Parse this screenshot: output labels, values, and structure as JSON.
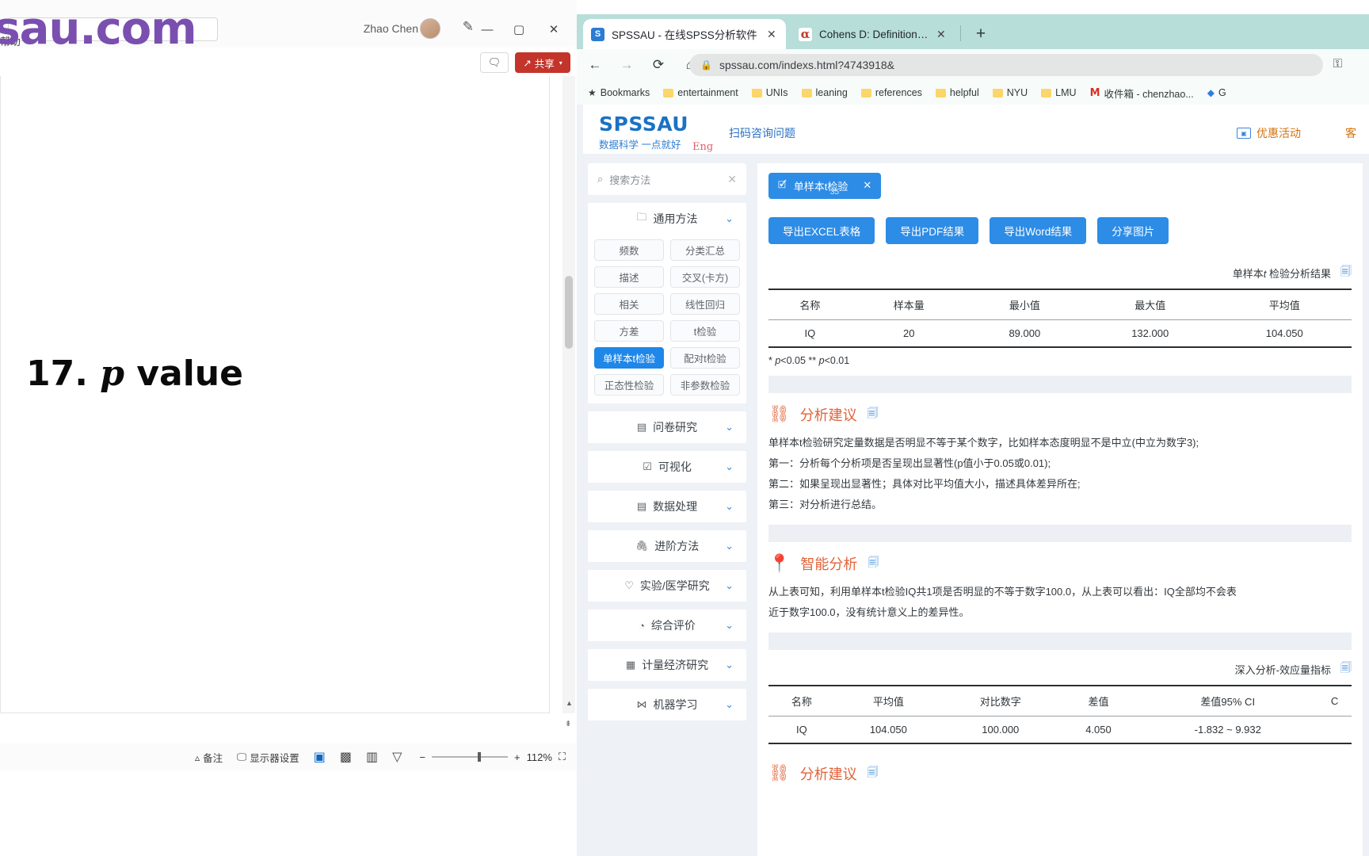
{
  "powerpoint": {
    "search_placeholder": "",
    "overlay_title": "ssau.com",
    "overlay_subtitle": "一点就好",
    "menu_hint": "帮助",
    "user_name": "Zhao Chen",
    "avatar": "avatar",
    "pen_icon": "pen-icon",
    "minimize": "—",
    "maximize": "▢",
    "close": "✕",
    "comment_label": "💬",
    "share_label": "共享",
    "share_caret": "▾",
    "slide_heading_num": "17. ",
    "slide_heading_ital": "p",
    "slide_heading_rest": " value",
    "statusbar": {
      "notes_label": "备注",
      "display_settings_label": "显示器设置",
      "view_normal": "▣",
      "view_sorter": "▩",
      "view_reading": "▥",
      "view_show": "▽",
      "zoom_out": "−",
      "zoom_in": "+",
      "zoom_level": "112%",
      "fit_label": "⛶"
    }
  },
  "chrome": {
    "tabs": [
      {
        "title": "SPSSAU - 在线SPSS分析软件",
        "favicon_letter": "S",
        "close": "✕",
        "active": true
      },
      {
        "title": "Cohens D: Definition, Using &",
        "favicon_letter": "α",
        "close": "✕",
        "active": false
      }
    ],
    "new_tab": "+",
    "nav": {
      "back": "←",
      "forward": "→",
      "reload": "⟳",
      "home": "⌂"
    },
    "omnibox": {
      "lock": "🔒",
      "url": "spssau.com/indexs.html?4743918&"
    },
    "extensions_icon": "key-icon",
    "bookmarks": [
      {
        "label": "Bookmarks",
        "icon": "star"
      },
      {
        "label": "entertainment",
        "icon": "folder"
      },
      {
        "label": "UNIs",
        "icon": "folder"
      },
      {
        "label": "leaning",
        "icon": "folder"
      },
      {
        "label": "references",
        "icon": "folder"
      },
      {
        "label": "helpful",
        "icon": "folder"
      },
      {
        "label": "NYU",
        "icon": "folder"
      },
      {
        "label": "LMU",
        "icon": "folder"
      },
      {
        "label": "收件箱 - chenzhao...",
        "icon": "gmail"
      },
      {
        "label": "G",
        "icon": "diamond"
      }
    ]
  },
  "spssau": {
    "logo": "SPSSAU",
    "slogan": "数据科学 一点就好",
    "eng_link": "Eng",
    "scan_link": "扫码咨询问题",
    "promo_label": "优惠活动",
    "service_label": "客",
    "search_placeholder": "搜索方法",
    "search_clear": "✕",
    "categories": [
      {
        "label": "通用方法",
        "icon": "folder-icon",
        "expanded": true,
        "methods": [
          "频数",
          "分类汇总",
          "描述",
          "交叉(卡方)",
          "相关",
          "线性回归",
          "方差",
          "t检验",
          "单样本t检验",
          "配对t检验",
          "正态性检验",
          "非参数检验"
        ],
        "active_method": "单样本t检验"
      },
      {
        "label": "问卷研究",
        "icon": "doc-icon",
        "expanded": false
      },
      {
        "label": "可视化",
        "icon": "chart-icon",
        "expanded": false
      },
      {
        "label": "数据处理",
        "icon": "database-icon",
        "expanded": false
      },
      {
        "label": "进阶方法",
        "icon": "clip-icon",
        "expanded": false
      },
      {
        "label": "实验/医学研究",
        "icon": "heart-icon",
        "expanded": false
      },
      {
        "label": "综合评价",
        "icon": "clock-icon",
        "expanded": false
      },
      {
        "label": "计量经济研究",
        "icon": "grid-icon",
        "expanded": false
      },
      {
        "label": "机器学习",
        "icon": "ml-icon",
        "expanded": false
      }
    ],
    "result_tab": {
      "label": "单样本t检验",
      "sub": "35",
      "icon": "edit-icon",
      "close": "✕"
    },
    "export_buttons": [
      "导出EXCEL表格",
      "导出PDF结果",
      "导出Word结果",
      "分享图片"
    ],
    "table1": {
      "caption_pre": "单样本",
      "caption_ital": "t",
      "caption_post": " 检验分析结果",
      "copy_icon": "copy-icon",
      "headers": [
        "名称",
        "样本量",
        "最小值",
        "最大值",
        "平均值"
      ],
      "rows": [
        [
          "IQ",
          "20",
          "89.000",
          "132.000",
          "104.050"
        ]
      ],
      "footnote_a": "* ",
      "footnote_b": "p",
      "footnote_c": "<0.05 ** ",
      "footnote_d": "p",
      "footnote_e": "<0.01"
    },
    "section_advice": {
      "title": "分析建议",
      "icon": "chain-icon",
      "copy_icon": "copy-icon",
      "lines": [
        "单样本t检验研究定量数据是否明显不等于某个数字，比如样本态度明显不是中立(中立为数字3);",
        "第一：分析每个分析项是否呈现出显著性(p值小于0.05或0.01);",
        "第二：如果呈现出显著性；具体对比平均值大小，描述具体差异所在;",
        "第三：对分析进行总结。"
      ]
    },
    "section_smart": {
      "title": "智能分析",
      "icon": "pin-icon",
      "copy_icon": "copy-icon",
      "lines": [
        "从上表可知，利用单样本t检验IQ共1项是否明显的不等于数字100.0，从上表可以看出：IQ全部均不会表",
        "近于数字100.0，没有统计意义上的差异性。"
      ]
    },
    "table2": {
      "caption": "深入分析-效应量指标",
      "copy_icon": "copy-icon",
      "headers": [
        "名称",
        "平均值",
        "对比数字",
        "差值",
        "差值95% CI",
        "C"
      ],
      "rows": [
        [
          "IQ",
          "104.050",
          "100.000",
          "4.050",
          "-1.832 ~ 9.932",
          ""
        ]
      ]
    },
    "section_advice2": {
      "title": "分析建议",
      "icon": "chain-icon",
      "copy_icon": "copy-icon"
    }
  }
}
